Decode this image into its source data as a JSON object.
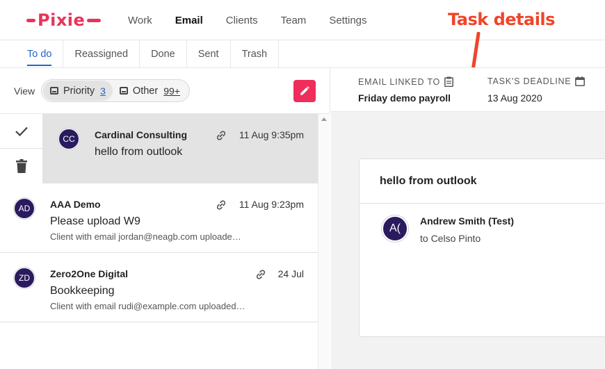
{
  "app": {
    "logo_text": "Pixie",
    "nav": [
      "Work",
      "Email",
      "Clients",
      "Team",
      "Settings"
    ],
    "active_nav": "Email"
  },
  "annotation": {
    "text": "Task details",
    "color": "#f0452a"
  },
  "tabs": [
    {
      "label": "To do",
      "active": true
    },
    {
      "label": "Reassigned"
    },
    {
      "label": "Done"
    },
    {
      "label": "Sent"
    },
    {
      "label": "Trash"
    }
  ],
  "toolbar": {
    "view_label": "View",
    "priority_label": "Priority",
    "priority_count": "3",
    "other_label": "Other",
    "other_count": "99+"
  },
  "emails": [
    {
      "initials": "CC",
      "sender": "Cardinal Consulting",
      "subject": "hello from outlook",
      "preview": "",
      "date": "11 Aug 9:35pm",
      "selected": true
    },
    {
      "initials": "AD",
      "sender": "AAA Demo",
      "subject": "Please upload W9",
      "preview": "Client with email jordan@neagb.com uploade…",
      "date": "11 Aug 9:23pm"
    },
    {
      "initials": "ZD",
      "sender": "Zero2One Digital",
      "subject": "Bookkeeping",
      "preview": "Client with email rudi@example.com uploaded…",
      "date": "24 Jul"
    }
  ],
  "details": {
    "email_linked_label": "EMAIL LINKED TO",
    "email_linked_value": "Friday demo payroll",
    "deadline_label": "TASK'S DEADLINE",
    "deadline_value": "13 Aug 2020"
  },
  "message": {
    "title": "hello from outlook",
    "avatar": "A(",
    "from": "Andrew Smith (Test)",
    "to": "to Celso Pinto"
  },
  "colors": {
    "brand": "#e8345a",
    "accent": "#2563c9",
    "avatar": "#2a1a5e",
    "compose": "#ee2d5b"
  }
}
